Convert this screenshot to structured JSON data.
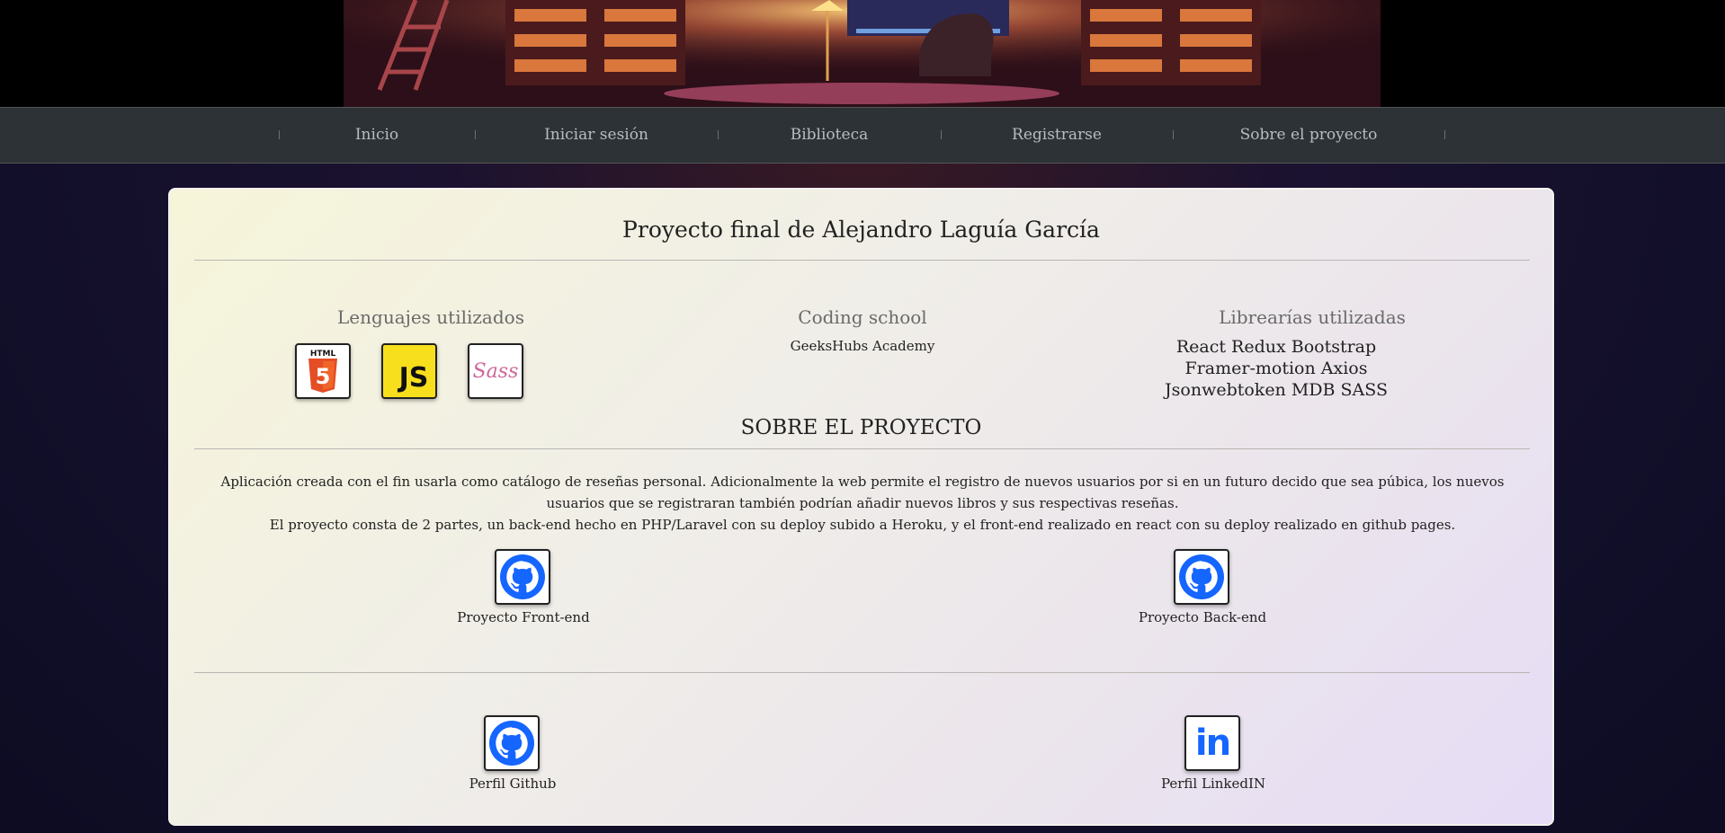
{
  "nav": {
    "items": [
      {
        "label": "Inicio"
      },
      {
        "label": "Iniciar sesión"
      },
      {
        "label": "Biblioteca"
      },
      {
        "label": "Registrarse"
      },
      {
        "label": "Sobre el proyecto"
      }
    ]
  },
  "card": {
    "title": "Proyecto final de Alejandro Laguía García",
    "languages": {
      "heading": "Lenguajes utilizados",
      "icons": [
        "html5-icon",
        "javascript-icon",
        "sass-icon"
      ],
      "html_label": "HTML",
      "js_label": "JS",
      "sass_label": "Sass"
    },
    "school": {
      "heading": "Coding school",
      "name": "GeeksHubs Academy"
    },
    "libraries": {
      "heading": "Librearías utilizadas",
      "line1": "React Redux Bootstrap",
      "line2": "Framer-motion Axios",
      "line3": "Jsonwebtoken MDB SASS"
    },
    "about": {
      "heading": "SOBRE EL PROYECTO",
      "paragraph1": "Aplicación creada con el fin usarla como catálogo de reseñas personal. Adicionalmente la web permite el registro de nuevos usuarios por si en un futuro decido que sea púbica, los nuevos usuarios que se registraran también podrían añadir nuevos libros y sus respectivas reseñas.",
      "paragraph2": "El proyecto consta de 2 partes, un back-end hecho en PHP/Laravel con su deploy subido a Heroku, y el front-end realizado en react con su deploy realizado en github pages."
    },
    "repos": {
      "frontend_label": "Proyecto Front-end",
      "backend_label": "Proyecto Back-end"
    },
    "profiles": {
      "github_label": "Perfil Github",
      "linkedin_label": "Perfil LinkedIN",
      "linkedin_logo": "in"
    }
  },
  "colors": {
    "nav_bg": "#2d3236",
    "accent_blue": "#1565ff",
    "js_yellow": "#f7df1e",
    "html_orange": "#e44d26",
    "sass_pink": "#cd6799"
  }
}
